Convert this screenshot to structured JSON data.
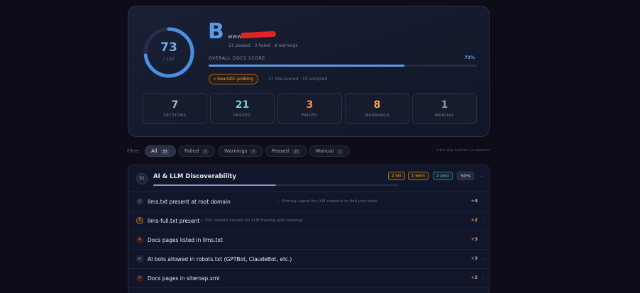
{
  "score": {
    "value": "73",
    "max": "/ 100",
    "fraction": 0.73
  },
  "site": {
    "letter": "B",
    "name": "www"
  },
  "summary": "21 passed · 3 failed · 8 warnings",
  "overall": {
    "label": "OVERALL DOCS SCORE",
    "pct": "73%",
    "fraction": 0.73
  },
  "probe": {
    "badge": "heuristic probing",
    "text": "17 discovered · 10 sampled"
  },
  "stats": [
    {
      "num": "7",
      "label": "SECTIONS",
      "color": "#aeb3c4"
    },
    {
      "num": "21",
      "label": "PASSED",
      "color": "#7fc7d6"
    },
    {
      "num": "3",
      "label": "FAILED",
      "color": "#f08a5a"
    },
    {
      "num": "8",
      "label": "WARNINGS",
      "color": "#f2a64d"
    },
    {
      "num": "1",
      "label": "MANUAL",
      "color": "#8a90a6"
    }
  ],
  "filter": {
    "label": "Filter",
    "chips": [
      {
        "label": "All",
        "count": "33"
      },
      {
        "label": "Failed",
        "count": "3"
      },
      {
        "label": "Warnings",
        "count": "8"
      },
      {
        "label": "Passed",
        "count": "21"
      },
      {
        "label": "Manual",
        "count": "1"
      }
    ],
    "hint": "click any section to expand"
  },
  "section": {
    "num": "S1",
    "title": "AI & LLM Discoverability",
    "fail": "2 fail",
    "warn": "1 warn",
    "pass": "2 pass",
    "pct": "50%",
    "fraction": 0.5,
    "items": [
      {
        "status": "pass",
        "icon": "✓",
        "name": "llms.txt present at root domain",
        "desc": "— Primary signal for LLM crawlers to find your docs",
        "points": "+4"
      },
      {
        "status": "warn",
        "icon": "!",
        "name": "llms-full.txt present",
        "desc": "— Full content version for LLM training and indexing",
        "points": "+2"
      },
      {
        "status": "fail",
        "icon": "✕",
        "name": "Docs pages listed in llms.txt",
        "desc": "",
        "points": "+3"
      },
      {
        "status": "pass",
        "icon": "✓",
        "name": "AI bots allowed in robots.txt (GPTBot, ClaudeBot, etc.)",
        "desc": "",
        "points": "+3"
      },
      {
        "status": "fail",
        "icon": "✕",
        "name": "Docs pages in sitemap.xml",
        "desc": "",
        "points": "+2"
      }
    ]
  }
}
